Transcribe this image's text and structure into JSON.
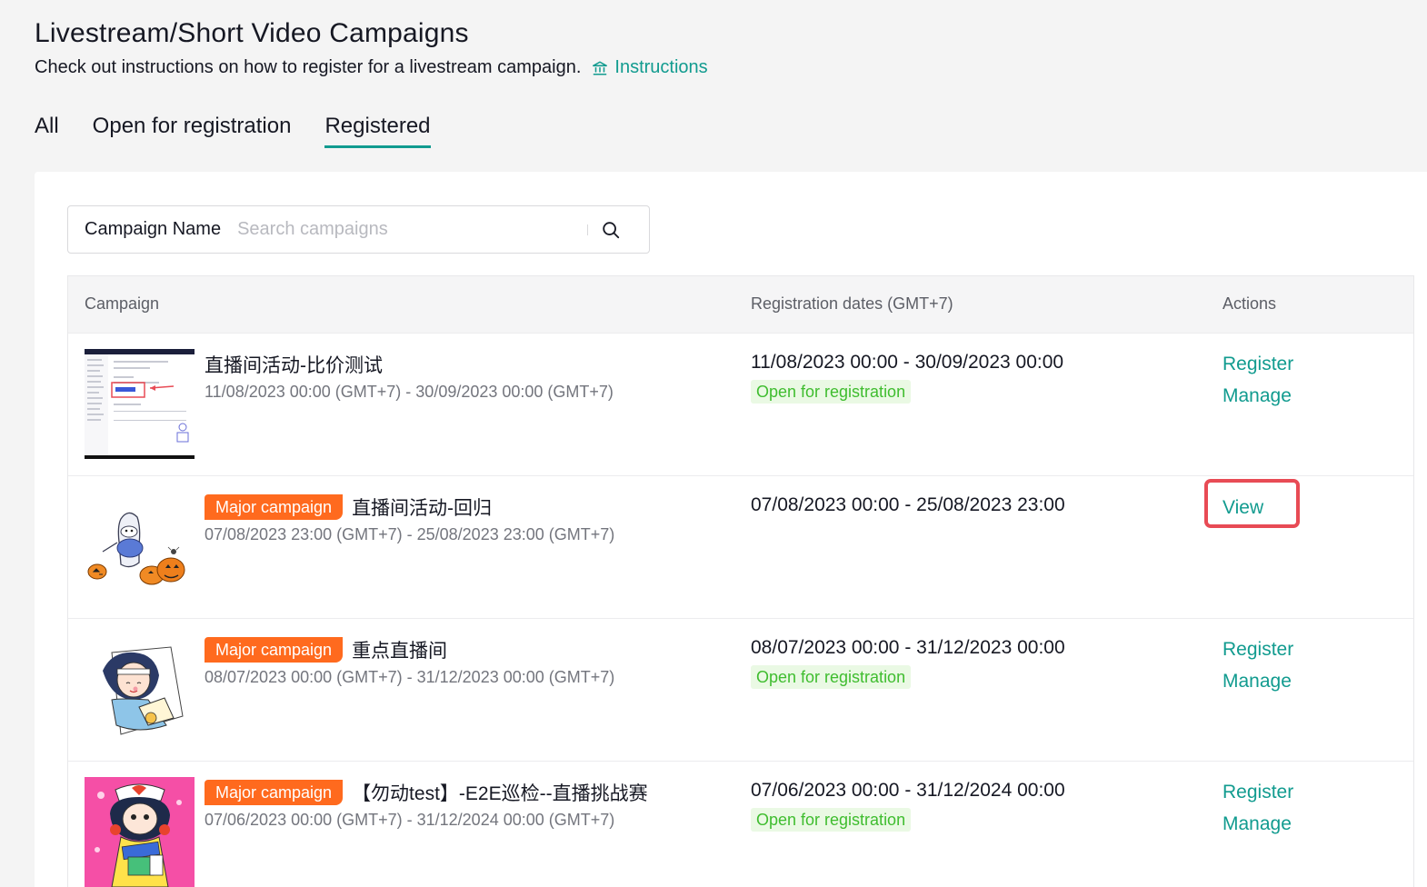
{
  "header": {
    "title": "Livestream/Short Video Campaigns",
    "subtitle": "Check out instructions on how to register for a livestream campaign.",
    "instructions_link": "Instructions"
  },
  "tabs": [
    {
      "label": "All",
      "active": false
    },
    {
      "label": "Open for registration",
      "active": false
    },
    {
      "label": "Registered",
      "active": true
    }
  ],
  "search": {
    "label": "Campaign Name",
    "placeholder": "Search campaigns",
    "value": ""
  },
  "table": {
    "columns": [
      "Campaign",
      "Registration dates (GMT+7)",
      "Actions"
    ],
    "rows": [
      {
        "badge": "",
        "name": "直播间活动-比价测试",
        "campaign_dates": "11/08/2023 00:00 (GMT+7) - 30/09/2023 00:00 (GMT+7)",
        "registration_dates": "11/08/2023 00:00 - 30/09/2023 00:00",
        "status": "Open for registration",
        "actions": [
          "Register",
          "Manage"
        ]
      },
      {
        "badge": "Major campaign",
        "name": "直播间活动-回归",
        "campaign_dates": "07/08/2023 23:00 (GMT+7) - 25/08/2023 23:00 (GMT+7)",
        "registration_dates": "07/08/2023 00:00 - 25/08/2023 23:00",
        "status": "",
        "actions": [
          "View"
        ]
      },
      {
        "badge": "Major campaign",
        "name": "重点直播间",
        "campaign_dates": "08/07/2023 00:00 (GMT+7) - 31/12/2023 00:00 (GMT+7)",
        "registration_dates": "08/07/2023 00:00 - 31/12/2023 00:00",
        "status": "Open for registration",
        "actions": [
          "Register",
          "Manage"
        ]
      },
      {
        "badge": "Major campaign",
        "name": "【勿动test】-E2E巡检--直播挑战赛",
        "campaign_dates": "07/06/2023 00:00 (GMT+7) - 31/12/2024 00:00 (GMT+7)",
        "registration_dates": "07/06/2023 00:00 - 31/12/2024 00:00",
        "status": "Open for registration",
        "actions": [
          "Register",
          "Manage"
        ]
      }
    ]
  },
  "colors": {
    "accent": "#119b8f",
    "badge": "#ff6a1e",
    "status_text": "#3fbd2f",
    "status_bg": "#eaf9e4",
    "highlight_border": "#e84b55"
  },
  "icons": {
    "instructions": "institution-icon",
    "search": "search-icon"
  }
}
